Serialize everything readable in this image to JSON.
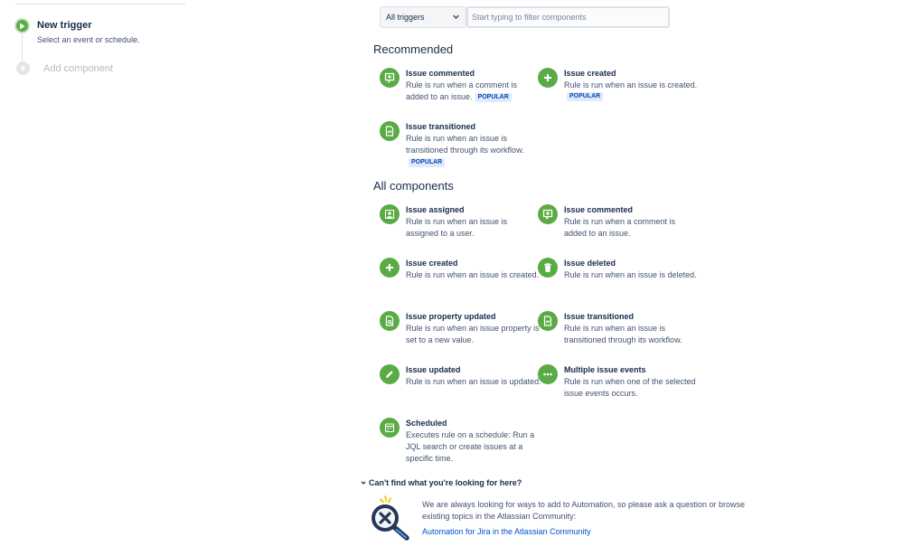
{
  "sidebar": {
    "trigger_title": "New trigger",
    "trigger_subtitle": "Select an event or schedule.",
    "add_component_label": "Add component"
  },
  "filter": {
    "select_value": "All triggers",
    "search_placeholder": "Start typing to filter components"
  },
  "sections": {
    "recommended_heading": "Recommended",
    "all_heading": "All components"
  },
  "recommended": [
    {
      "title": "Issue commented",
      "description": "Rule is run when a comment is added to an issue.",
      "badge": "POPULAR",
      "icon": "comment-icon"
    },
    {
      "title": "Issue created",
      "description": "Rule is run when an issue is created.",
      "badge": "POPULAR",
      "icon": "plus-icon"
    },
    {
      "title": "Issue transitioned",
      "description": "Rule is run when an issue is transitioned through its workflow.",
      "badge": "POPULAR",
      "icon": "transition-icon"
    }
  ],
  "all_components": [
    {
      "title": "Issue assigned",
      "description": "Rule is run when an issue is assigned to a user.",
      "icon": "user-assign-icon"
    },
    {
      "title": "Issue commented",
      "description": "Rule is run when a comment is added to an issue.",
      "icon": "comment-icon"
    },
    {
      "title": "Issue created",
      "description": "Rule is run when an issue is created.",
      "icon": "plus-icon"
    },
    {
      "title": "Issue deleted",
      "description": "Rule is run when an issue is deleted.",
      "icon": "trash-icon"
    },
    {
      "title": "Issue property updated",
      "description": "Rule is run when an issue property is set to a new value.",
      "icon": "property-icon"
    },
    {
      "title": "Issue transitioned",
      "description": "Rule is run when an issue is transitioned through its workflow.",
      "icon": "transition-icon"
    },
    {
      "title": "Issue updated",
      "description": "Rule is run when an issue is updated.",
      "icon": "pencil-icon"
    },
    {
      "title": "Multiple issue events",
      "description": "Rule is run when one of the selected issue events occurs.",
      "icon": "ellipsis-icon"
    },
    {
      "title": "Scheduled",
      "description": "Executes rule on a schedule: Run a JQL search or create issues at a specific time.",
      "icon": "calendar-icon"
    }
  ],
  "help": {
    "toggle_label": "Can't find what you're looking for here?",
    "text": "We are always looking for ways to add to Automation, so please ask a question or browse existing topics in the Atlassian Community:",
    "link_text": "Automation for Jira in the Atlassian Community"
  },
  "colors": {
    "accent_green": "#5aab45",
    "link_blue": "#0052cc",
    "badge_bg": "#deebff",
    "badge_text": "#0747a6"
  }
}
